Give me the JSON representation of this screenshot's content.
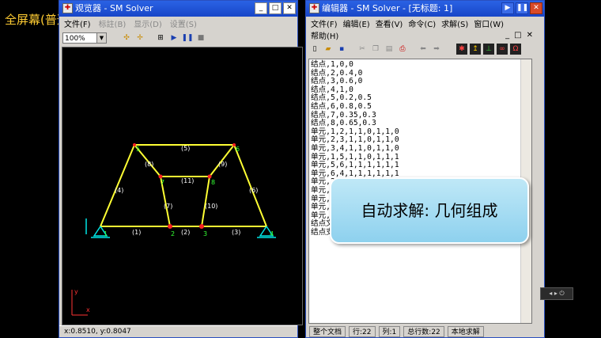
{
  "overlay": {
    "fullscreen_label": "全屏幕(普通)"
  },
  "viewer": {
    "title": "观览器 - SM Solver",
    "menu": [
      "文件(F)",
      "标註(B)",
      "显示(D)",
      "设置(S)"
    ],
    "zoom": "100%",
    "status": "x:0.8510, y:0.8047",
    "node_labels": [
      "1",
      "2",
      "3",
      "4",
      "5",
      "6",
      "7",
      "8"
    ],
    "element_labels": [
      "(1)",
      "(2)",
      "(3)",
      "(4)",
      "(5)",
      "(6)",
      "(7)",
      "(8)",
      "(9)",
      "(10)",
      "(11)"
    ],
    "axis_x": "x",
    "axis_y": "y",
    "colors": {
      "structure": "#ffff33",
      "node": "#ff2222",
      "support": "#00e5e5",
      "element_label": "#ffffff",
      "node_label": "#33ff33"
    }
  },
  "editor": {
    "title": "编辑器 - SM Solver - [无标题: 1]",
    "menu": [
      "文件(F)",
      "编辑(E)",
      "查看(V)",
      "命令(C)",
      "求解(S)",
      "窗口(W)"
    ],
    "menu2": [
      "帮助(H)"
    ],
    "lines": [
      "结点,1,0,0",
      "结点,2,0.4,0",
      "结点,3,0.6,0",
      "结点,4,1,0",
      "结点,5,0.2,0.5",
      "结点,6,0.8,0.5",
      "结点,7,0.35,0.3",
      "结点,8,0.65,0.3",
      "单元,1,2,1,1,0,1,1,0",
      "单元,2,3,1,1,0,1,1,0",
      "单元,3,4,1,1,0,1,1,0",
      "单元,1,5,1,1,0,1,1,1",
      "单元,5,6,1,1,1,1,1,1",
      "单元,6,4,1,1,1,1,1,1",
      "单元,2",
      "单元,7",
      "单元,8",
      "单元,3",
      "单元,7",
      "结点文",
      "结点支"
    ],
    "status": {
      "scope": "整个文档",
      "row": "行:22",
      "col": "列:1",
      "total": "总行数:22",
      "solve": "本地求解"
    }
  },
  "callout": {
    "text": "自动求解: 几何组成"
  }
}
